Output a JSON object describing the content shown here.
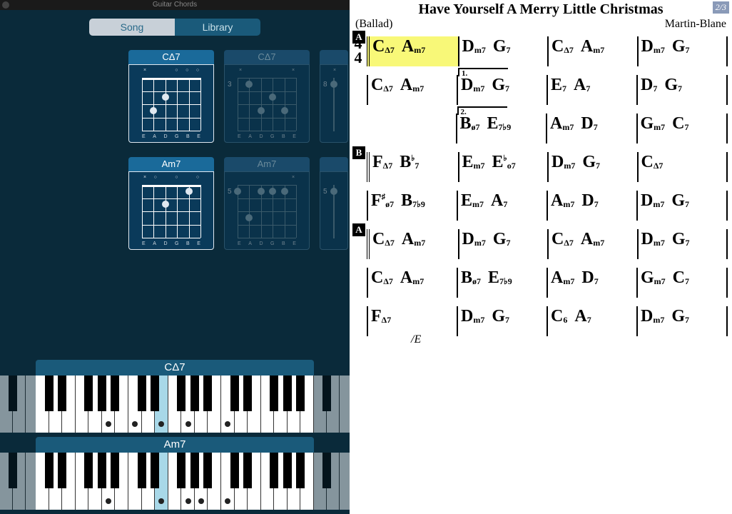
{
  "app_title": "Guitar Chords",
  "tabs": {
    "song": "Song",
    "library": "Library"
  },
  "guitar_rows": [
    {
      "main": "CΔ7",
      "alt1": "CΔ7",
      "alt1_fret": "3",
      "alt2_fret": "8"
    },
    {
      "main": "Am7",
      "alt1": "Am7",
      "alt1_fret": "5",
      "alt2_fret": "5"
    }
  ],
  "string_names": [
    "E",
    "A",
    "D",
    "G",
    "B",
    "E"
  ],
  "piano": [
    {
      "label": "CΔ7"
    },
    {
      "label": "Am7"
    }
  ],
  "sheet": {
    "title": "Have Yourself A Merry Little Christmas",
    "page": "2/3",
    "style": "(Ballad)",
    "composer": "Martin-Blane",
    "time_top": "4",
    "time_bot": "4",
    "sections": {
      "A": "A",
      "B": "B"
    },
    "volta1": "1.",
    "volta2": "2.",
    "bass_E": "/E",
    "lines": [
      [
        [
          "C",
          "Δ7",
          "A",
          "m7"
        ],
        [
          "D",
          "m7",
          "G",
          "7"
        ],
        [
          "C",
          "Δ7",
          "A",
          "m7"
        ],
        [
          "D",
          "m7",
          "G",
          "7"
        ]
      ],
      [
        [
          "C",
          "Δ7",
          "A",
          "m7"
        ],
        [
          "D",
          "m7",
          "G",
          "7"
        ],
        [
          "E",
          "7",
          "A",
          "7"
        ],
        [
          "D",
          "7",
          "G",
          "7"
        ]
      ],
      [
        [
          "",
          "",
          "",
          ""
        ],
        [
          "B",
          "ø7",
          "E",
          "7♭9"
        ],
        [
          "A",
          "m7",
          "D",
          "7"
        ],
        [
          "G",
          "m7",
          "C",
          "7"
        ]
      ],
      [
        [
          "F",
          "Δ7",
          "B♭",
          "7"
        ],
        [
          "E",
          "m7",
          "E♭",
          "o7"
        ],
        [
          "D",
          "m7",
          "G",
          "7"
        ],
        [
          "C",
          "Δ7",
          "",
          ""
        ]
      ],
      [
        [
          "F♯",
          "ø7",
          "B",
          "7♭9"
        ],
        [
          "E",
          "m7",
          "A",
          "7"
        ],
        [
          "A",
          "m7",
          "D",
          "7"
        ],
        [
          "D",
          "m7",
          "G",
          "7"
        ]
      ],
      [
        [
          "C",
          "Δ7",
          "A",
          "m7"
        ],
        [
          "D",
          "m7",
          "G",
          "7"
        ],
        [
          "C",
          "Δ7",
          "A",
          "m7"
        ],
        [
          "D",
          "m7",
          "G",
          "7"
        ]
      ],
      [
        [
          "C",
          "Δ7",
          "A",
          "m7"
        ],
        [
          "B",
          "ø7",
          "E",
          "7♭9"
        ],
        [
          "A",
          "m7",
          "D",
          "7"
        ],
        [
          "G",
          "m7",
          "C",
          "7"
        ]
      ],
      [
        [
          "F",
          "Δ7",
          "",
          ""
        ],
        [
          "D",
          "m7",
          "G",
          "7"
        ],
        [
          "C",
          "6",
          "A",
          "7"
        ],
        [
          "D",
          "m7",
          "G",
          "7"
        ]
      ]
    ]
  }
}
